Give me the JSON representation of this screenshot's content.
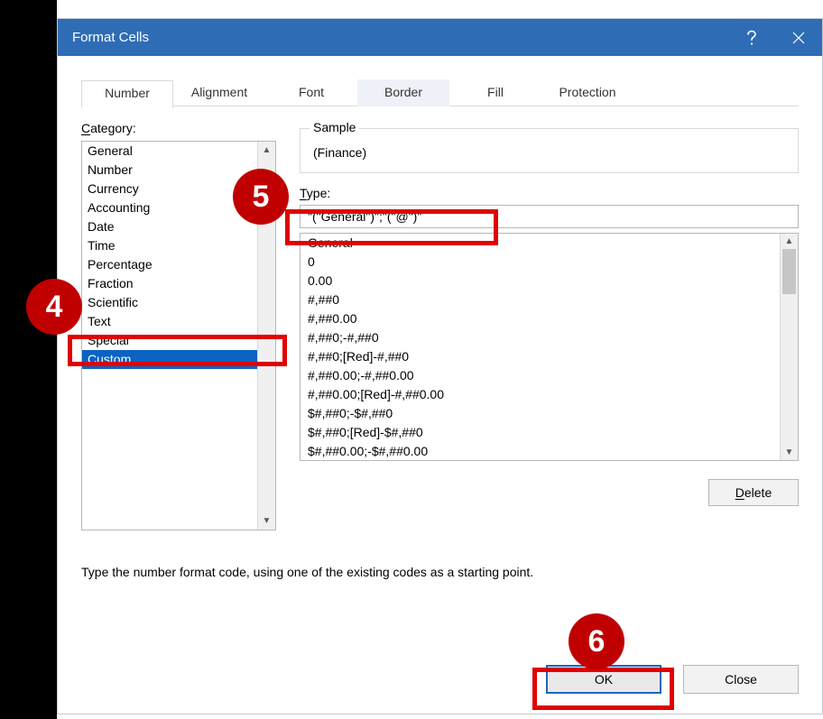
{
  "dialog": {
    "title": "Format Cells"
  },
  "tabs": {
    "number": "Number",
    "alignment": "Alignment",
    "font": "Font",
    "border": "Border",
    "fill": "Fill",
    "protection": "Protection"
  },
  "category": {
    "label_pre": "C",
    "label_post": "ategory:",
    "items": [
      "General",
      "Number",
      "Currency",
      "Accounting",
      "Date",
      "Time",
      "Percentage",
      "Fraction",
      "Scientific",
      "Text",
      "Special",
      "Custom"
    ],
    "selected": "Custom"
  },
  "sample": {
    "legend": "Sample",
    "value": "(Finance)"
  },
  "type": {
    "label_pre": "T",
    "label_post": "ype:",
    "value": "\"(\"General\")\";\"(\"@\")\""
  },
  "codes": {
    "items": [
      "General",
      "0",
      "0.00",
      "#,##0",
      "#,##0.00",
      "#,##0;-#,##0",
      "#,##0;[Red]-#,##0",
      "#,##0.00;-#,##0.00",
      "#,##0.00;[Red]-#,##0.00",
      "$#,##0;-$#,##0",
      "$#,##0;[Red]-$#,##0",
      "$#,##0.00;-$#,##0.00"
    ]
  },
  "buttons": {
    "delete_pre": "D",
    "delete_post": "elete",
    "ok": "OK",
    "close": "Close"
  },
  "hint": "Type the number format code, using one of the existing codes as a starting point.",
  "callouts": {
    "c4": "4",
    "c5": "5",
    "c6": "6"
  }
}
